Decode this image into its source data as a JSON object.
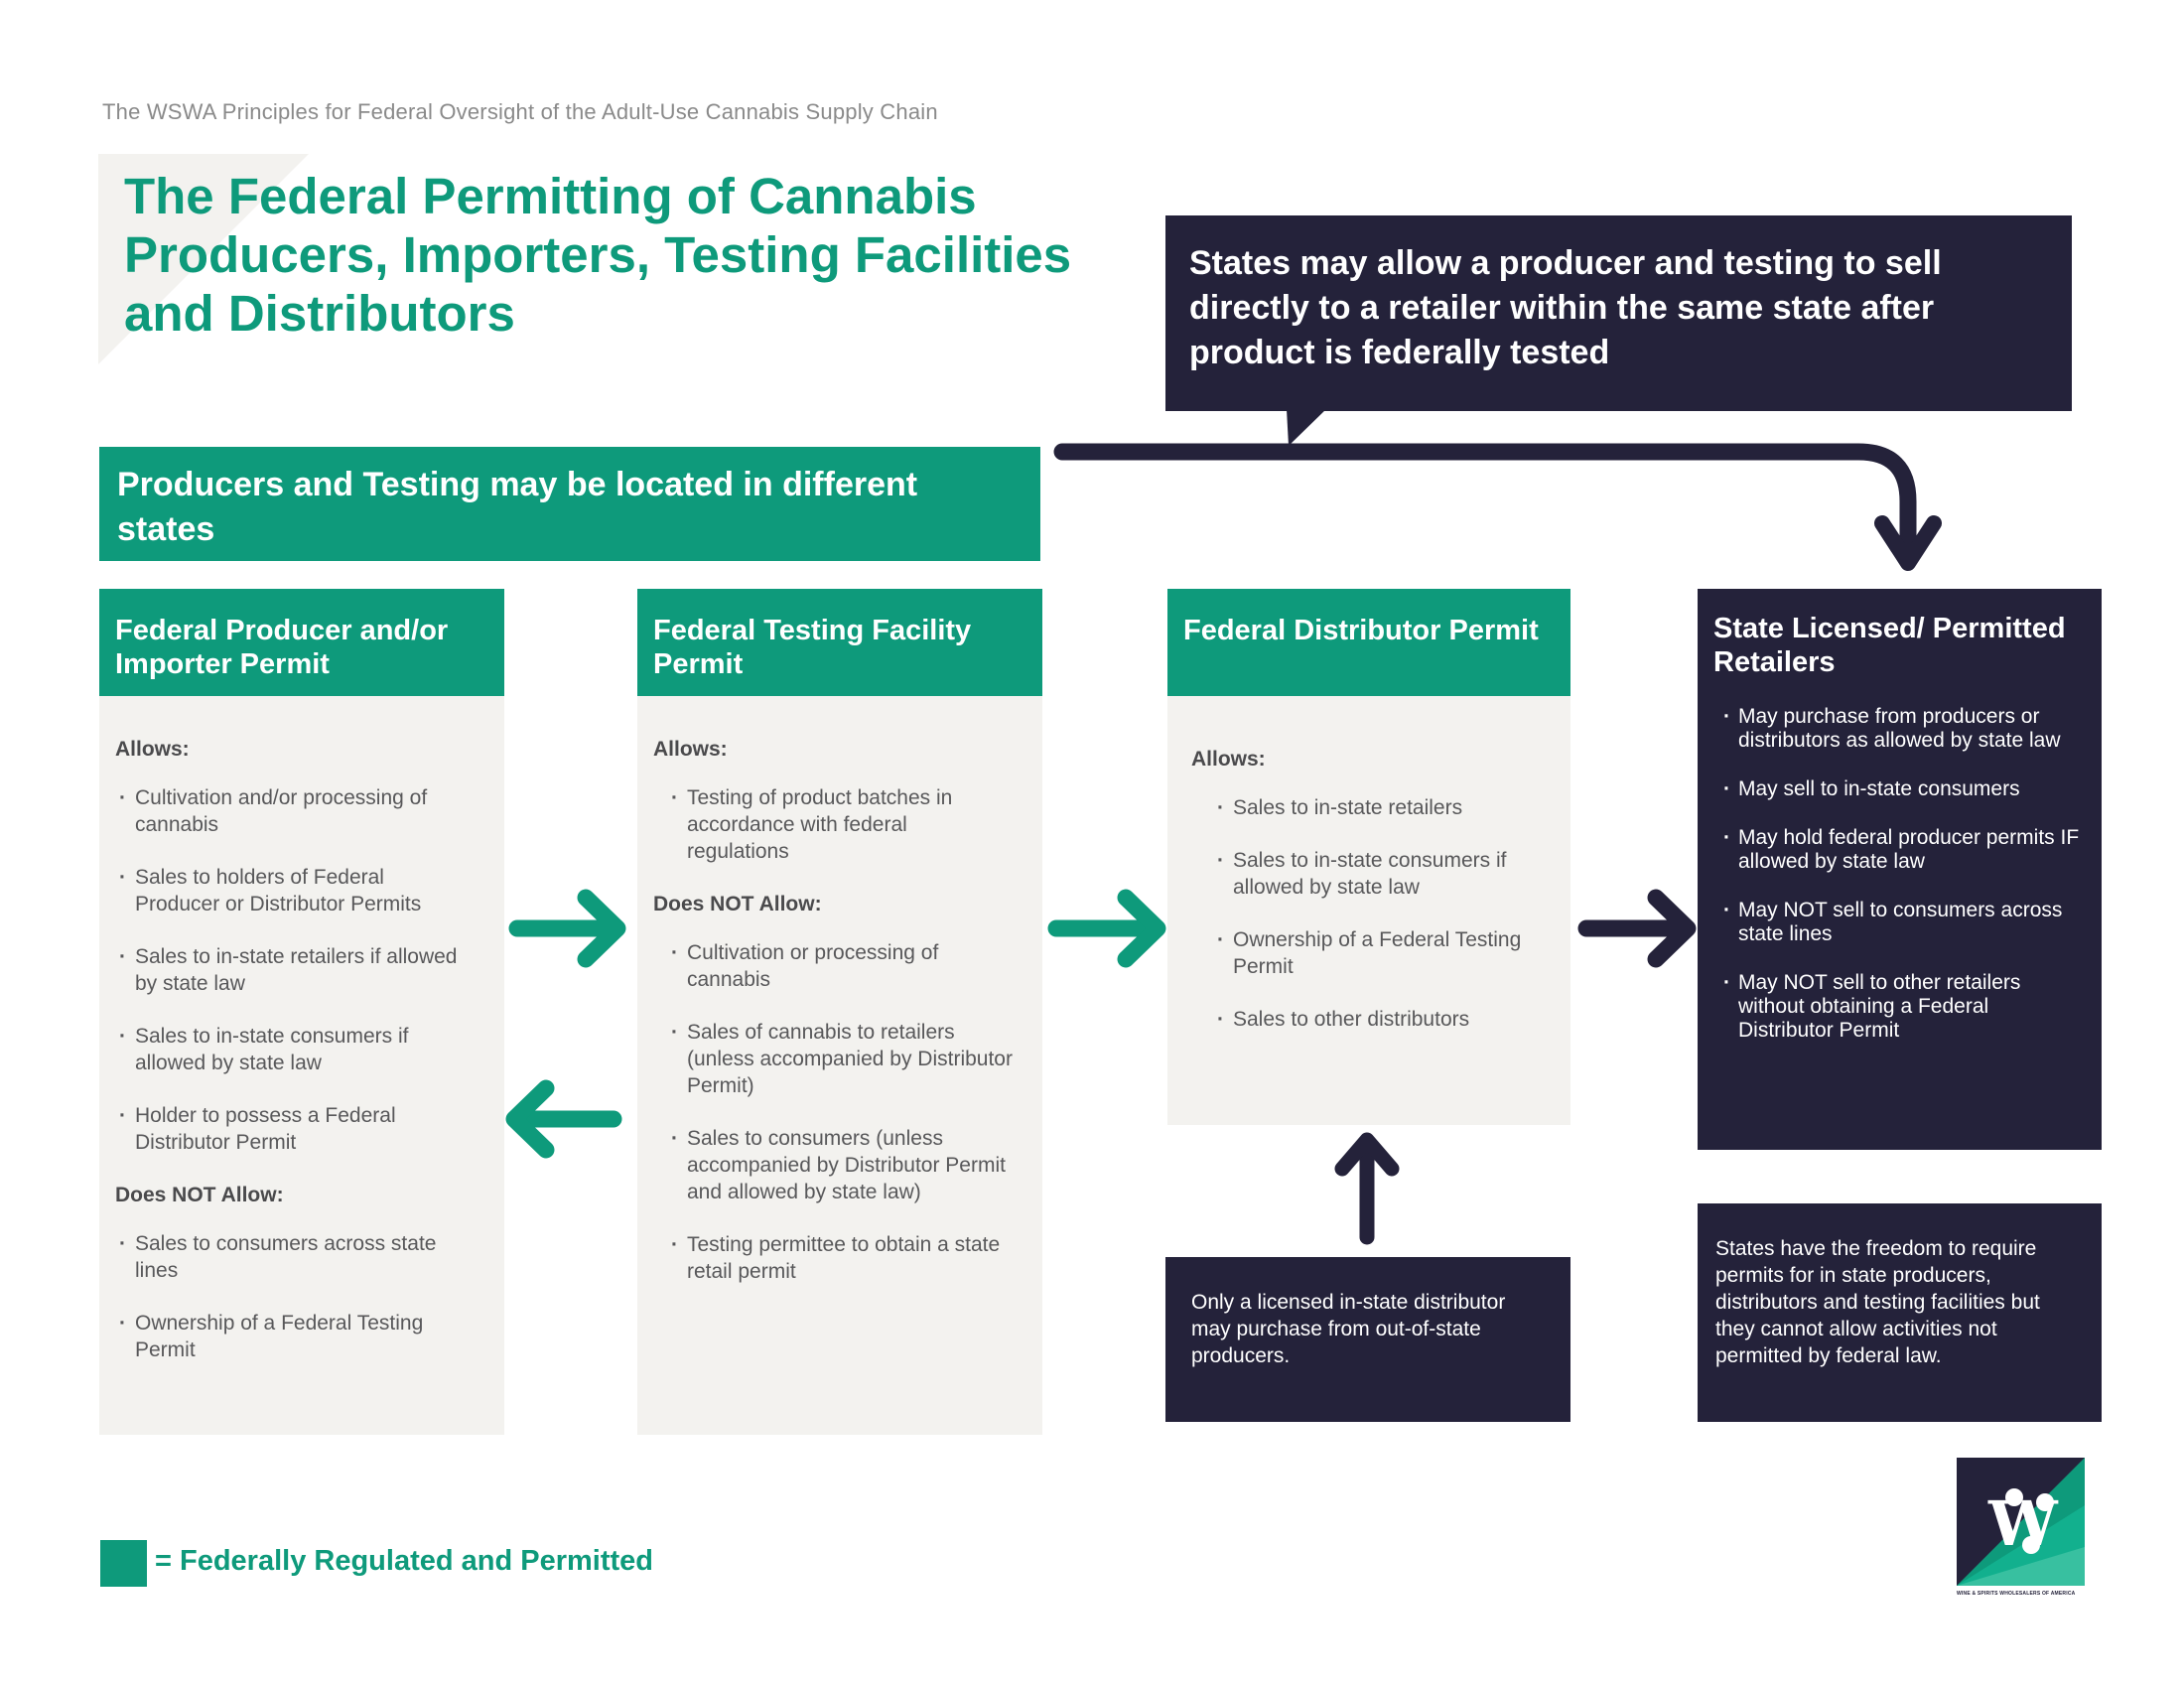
{
  "header": {
    "subtitle": "The WSWA Principles for Federal Oversight of the Adult-Use Cannabis Supply Chain",
    "title": "The Federal Permitting of Cannabis Producers, Importers, Testing Facilities and Distributors"
  },
  "callout": {
    "text": "States may allow a producer and testing to sell directly to a retailer within the same state after product is federally tested"
  },
  "banner": {
    "text": "Producers and Testing may be located in different states"
  },
  "columns": [
    {
      "title": "Federal Producer and/or Importer Permit",
      "allows_label": "Allows:",
      "allows": [
        "Cultivation and/or processing of cannabis",
        "Sales to holders of Federal Producer or Distributor Permits",
        "Sales to in-state retailers if allowed by state law",
        "Sales to in-state consumers if allowed by state law",
        "Holder to possess a Federal Distributor Permit"
      ],
      "not_allow_label": "Does NOT Allow:",
      "not_allow": [
        "Sales to consumers across state lines",
        "Ownership of a Federal Testing Permit"
      ]
    },
    {
      "title": "Federal Testing Facility Permit",
      "allows_label": "Allows:",
      "allows": [
        "Testing of product batches in accordance with federal regulations"
      ],
      "not_allow_label": "Does NOT Allow:",
      "not_allow": [
        "Cultivation or processing of cannabis",
        "Sales of cannabis to retailers (unless accompanied by Distributor Permit)",
        "Sales to consumers (unless accompanied by Distributor Permit and allowed by state law)",
        "Testing permittee to obtain a state retail permit"
      ]
    },
    {
      "title": "Federal Distributor Permit",
      "allows_label": "Allows:",
      "allows": [
        "Sales to in-state retailers",
        "Sales to in-state consumers if allowed by state law",
        "Ownership of a Federal Testing Permit",
        "Sales to other distributors"
      ]
    }
  ],
  "retailers": {
    "title": "State Licensed/ Permitted Retailers",
    "items": [
      "May purchase from producers or distributors as allowed by state law",
      "May sell to in-state consumers",
      "May hold federal producer permits IF allowed by state law",
      "May NOT sell to consumers across state lines",
      "May NOT sell to other retailers without obtaining a Federal Distributor Permit"
    ]
  },
  "notes": {
    "distributor_note": "Only a licensed in-state distributor may purchase from out-of-state producers.",
    "states_note": "States have the freedom to require permits for in state producers, distributors and testing facilities but they cannot allow activities not permitted by federal law."
  },
  "legend": {
    "text": "= Federally Regulated and Permitted"
  },
  "logo": {
    "letter": "W",
    "caption": "WINE & SPIRITS WHOLESALERS OF AMERICA"
  },
  "colors": {
    "green": "#0e9a7b",
    "navy": "#24223a",
    "panel": "#f3f2ef",
    "text_gray": "#58585a"
  }
}
